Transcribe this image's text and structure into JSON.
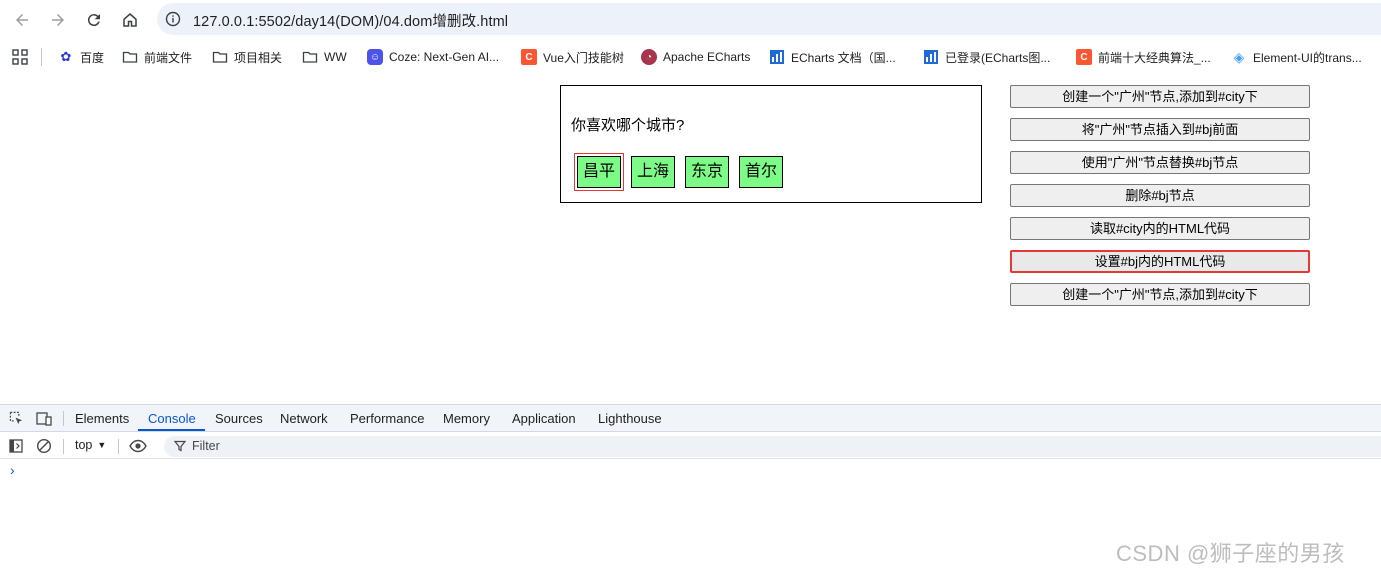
{
  "browser": {
    "url": "127.0.0.1:5502/day14(DOM)/04.dom增删改.html"
  },
  "bookmarks": [
    {
      "label": "百度",
      "icon": "baidu-icon"
    },
    {
      "label": "前端文件",
      "icon": "folder-icon"
    },
    {
      "label": "项目相关",
      "icon": "folder-icon"
    },
    {
      "label": "WW",
      "icon": "folder-icon"
    },
    {
      "label": "Coze: Next-Gen AI...",
      "icon": "coze-icon"
    },
    {
      "label": "Vue入门技能树",
      "icon": "csdn-icon"
    },
    {
      "label": "Apache ECharts",
      "icon": "echarts-icon"
    },
    {
      "label": "ECharts 文档（国...",
      "icon": "chart-icon"
    },
    {
      "label": "已登录(ECharts图...",
      "icon": "chart-icon"
    },
    {
      "label": "前端十大经典算法_...",
      "icon": "csdn-icon"
    },
    {
      "label": "Element-UI的trans...",
      "icon": "element-icon"
    }
  ],
  "page": {
    "question": "你喜欢哪个城市?",
    "cities": [
      "昌平",
      "上海",
      "东京",
      "首尔"
    ],
    "buttons": [
      "创建一个\"广州\"节点,添加到#city下",
      "将\"广州\"节点插入到#bj前面",
      "使用\"广州\"节点替换#bj节点",
      "删除#bj节点",
      "读取#city内的HTML代码",
      "设置#bj内的HTML代码",
      "创建一个\"广州\"节点,添加到#city下"
    ]
  },
  "devtools": {
    "tabs": [
      "Elements",
      "Console",
      "Sources",
      "Network",
      "Performance",
      "Memory",
      "Application",
      "Lighthouse"
    ],
    "active_tab": "Console",
    "context": "top",
    "filter_placeholder": "Filter",
    "prompt": "›"
  },
  "watermark": "CSDN @狮子座的男孩",
  "colors": {
    "accent": "#0b57d0",
    "city_bg": "#7cfc87",
    "highlight": "#e53935"
  }
}
